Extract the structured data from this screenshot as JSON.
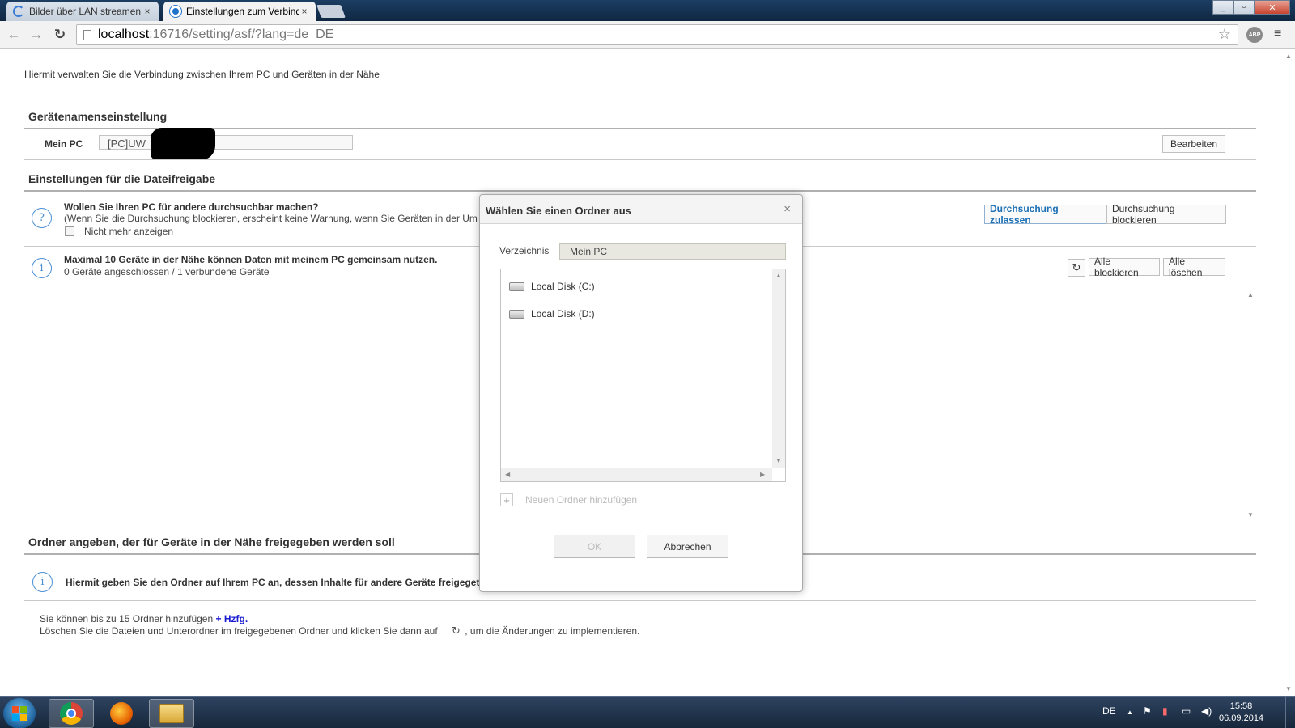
{
  "browser": {
    "tabs": [
      {
        "title": "Bilder über LAN streamen",
        "close": "×"
      },
      {
        "title": "Einstellungen zum Verbind",
        "close": "×"
      }
    ],
    "url_host": "localhost",
    "url_path": ":16716/setting/asf/?lang=de_DE",
    "nav_back": "←",
    "nav_forward": "→",
    "nav_reload": "↻",
    "star": "☆",
    "ext_abp": "ABP",
    "menu": "≡"
  },
  "page": {
    "intro": "Hiermit verwalten Sie die Verbindung zwischen Ihrem PC und Geräten in der Nähe",
    "device_name_section": {
      "title": "Gerätenamenseinstellung",
      "label": "Mein PC",
      "value": "[PC]UW",
      "edit_button": "Bearbeiten"
    },
    "file_sharing_section": {
      "title": "Einstellungen für die Dateifreigabe",
      "question_icon": "?",
      "question": "Wollen Sie Ihren PC für andere durchsuchbar machen?",
      "question_note": "(Wenn Sie die Durchsuchung blockieren, erscheint keine Warnung, wenn Sie Geräten in der Um",
      "dont_show_again": "Nicht mehr anzeigen",
      "allow_button": "Durchsuchung zulassen",
      "block_button": "Durchsuchung blockieren",
      "info_icon": "i",
      "limit_text": "Maximal 10 Geräte in der Nähe können Daten mit meinem PC gemeinsam nutzen.",
      "status_text": "0 Geräte angeschlossen / 1 verbundene Geräte",
      "refresh_icon": "↻",
      "block_all_button": "Alle blockieren",
      "delete_all_button": "Alle löschen"
    },
    "folder_section": {
      "title": "Ordner angeben, der für Geräte in der Nähe freigegeben werden soll",
      "info_icon": "i",
      "info_text": "Hiermit geben Sie den Ordner auf Ihrem PC an, dessen Inhalte für andere Geräte freigeget",
      "limit_text": "Sie können bis zu 15 Ordner hinzufügen",
      "add_link": "+ Hzfg.",
      "delete_text_before": "Löschen Sie die Dateien und Unterordner im freigegebenen Ordner und klicken Sie dann auf",
      "delete_text_after": ", um die Änderungen zu implementieren.",
      "refresh_icon": "↻"
    }
  },
  "dialog": {
    "title": "Wählen Sie einen Ordner aus",
    "close": "×",
    "directory_label": "Verzeichnis",
    "directory_value": "Mein PC",
    "items": [
      {
        "label": "Local Disk (C:)"
      },
      {
        "label": "Local Disk (D:)"
      }
    ],
    "add_folder_icon": "+",
    "add_folder_label": "Neuen Ordner hinzufügen",
    "ok_button": "OK",
    "cancel_button": "Abbrechen"
  },
  "taskbar": {
    "language": "DE",
    "tray_arrow": "▲",
    "time": "15:58",
    "date": "06.09.2014"
  }
}
